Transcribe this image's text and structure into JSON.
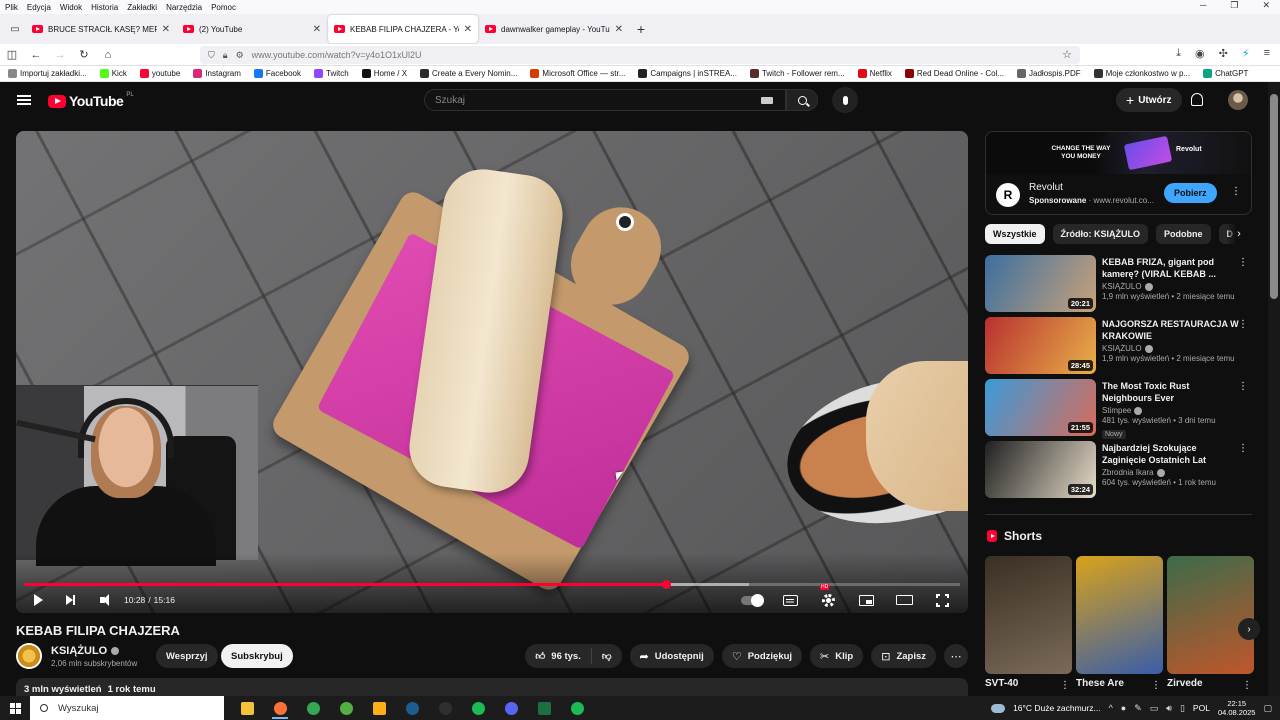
{
  "browser": {
    "menu": [
      "Plik",
      "Edycja",
      "Widok",
      "Historia",
      "Zakładki",
      "Narzędzia",
      "Pomoc"
    ],
    "tabs": [
      {
        "title": "BRUCE STRACIŁ KASĘ? MERGHANI",
        "active": false
      },
      {
        "title": "(2) YouTube",
        "active": false
      },
      {
        "title": "KEBAB FILIPA CHAJZERA - YouTube",
        "active": true
      },
      {
        "title": "dawnwalker gameplay - YouTube",
        "active": false
      }
    ],
    "url": "www.youtube.com/watch?v=y4o1O1xUl2U",
    "bookmarks": [
      "Importuj zakładki...",
      "Kick",
      "youtube",
      "Instagram",
      "Facebook",
      "Twitch",
      "Home / X",
      "Create a Every Nomin...",
      "Microsoft Office — str...",
      "Campaigns | inSTREA...",
      "Twitch - Follower rem...",
      "Netflix",
      "Red Dead Online - Col...",
      "Jadłospis.PDF",
      "Moje członkostwo w p...",
      "ChatGPT"
    ],
    "bookmark_colors": [
      "#888888",
      "#53fc18",
      "#ff0033",
      "#d62976",
      "#1877f2",
      "#9146ff",
      "#111111",
      "#2b2b2b",
      "#d83b01",
      "#222222",
      "#5a2d2d",
      "#e50914",
      "#8b0000",
      "#666666",
      "#333333",
      "#10a37f"
    ]
  },
  "youtube": {
    "logo": "YouTube",
    "country": "PL",
    "search_placeholder": "Szukaj",
    "create_label": "Utwórz",
    "player": {
      "current_time": "10:28",
      "separator": "/",
      "duration": "15:16",
      "played_fraction": 0.686,
      "buffered_fraction": 0.775,
      "hd_badge": "HD"
    },
    "video": {
      "title": "KEBAB FILIPA CHAJZERA",
      "channel": "KSIĄŻULO",
      "subscribers": "2,06 mln subskrybentów",
      "join_label": "Wesprzyj",
      "subscribe_label": "Subskrybuj",
      "likes": "96 tys.",
      "share_label": "Udostępnij",
      "thanks_label": "Podziękuj",
      "clip_label": "Klip",
      "save_label": "Zapisz",
      "views": "3 mln wyświetleń",
      "age": "1 rok temu"
    },
    "ad": {
      "slogan": "CHANGE THE WAY YOU MONEY",
      "brand": "Revolut",
      "sponsored": "Sponsorowane",
      "domain": "www.revolut.co...",
      "cta": "Pobierz"
    },
    "chips": [
      "Wszystkie",
      "Źródło: KSIĄŻULO",
      "Podobne",
      "D"
    ],
    "recommendations": [
      {
        "title": "KEBAB FRIZA, gigant pod kamerę? (VIRAL KEBAB ...",
        "channel": "KSIĄŻULO",
        "meta": "1,9 mln wyświetleń • 2 miesiące temu",
        "duration": "20:21",
        "badge": "",
        "color_a": "#3b6fa0",
        "color_b": "#c9a27a"
      },
      {
        "title": "NAJGORSZA RESTAURACJA W KRAKOWIE",
        "channel": "KSIĄŻULO",
        "meta": "1,9 mln wyświetleń • 2 miesiące temu",
        "duration": "28:45",
        "badge": "",
        "color_a": "#b8312f",
        "color_b": "#e8b04a"
      },
      {
        "title": "The Most Toxic Rust Neighbours Ever",
        "channel": "Stimpee",
        "meta": "481 tys. wyświetleń • 3 dni temu",
        "duration": "21:55",
        "badge": "Nowy",
        "color_a": "#3a9bd9",
        "color_b": "#d76c5a"
      },
      {
        "title": "Najbardziej Szokujące Zaginięcie Ostatnich Lat",
        "channel": "Zbrodnia Ikara",
        "meta": "604 tys. wyświetleń • 1 rok temu",
        "duration": "32:24",
        "badge": "",
        "color_a": "#202020",
        "color_b": "#e6dcc8"
      }
    ],
    "shorts_heading": "Shorts",
    "shorts": [
      {
        "title": "SVT-40",
        "color_a": "#3a2f24",
        "color_b": "#7a6a58"
      },
      {
        "title": "These Are",
        "color_a": "#d9a21b",
        "color_b": "#3a5ea8"
      },
      {
        "title": "Zirvede",
        "color_a": "#3d6b4a",
        "color_b": "#c0562b"
      }
    ]
  },
  "taskbar": {
    "search_placeholder": "Wyszukaj",
    "weather": "16°C  Duże zachmurz...",
    "language": "POL",
    "time": "22:15",
    "date": "04.08.2025",
    "apps": [
      {
        "name": "file-explorer",
        "color": "#f3c13a"
      },
      {
        "name": "firefox",
        "color": "#ff7139"
      },
      {
        "name": "chrome",
        "color": "#34a853"
      },
      {
        "name": "xbox",
        "color": "#52b043"
      },
      {
        "name": "rockstar",
        "color": "#fcaf17"
      },
      {
        "name": "steam",
        "color": "#1b5d8f"
      },
      {
        "name": "obs",
        "color": "#302e31"
      },
      {
        "name": "spotify",
        "color": "#1db954"
      },
      {
        "name": "app",
        "color": "#5865f2"
      },
      {
        "name": "excel",
        "color": "#1d6f42"
      },
      {
        "name": "spotify-2",
        "color": "#1db954"
      }
    ]
  }
}
